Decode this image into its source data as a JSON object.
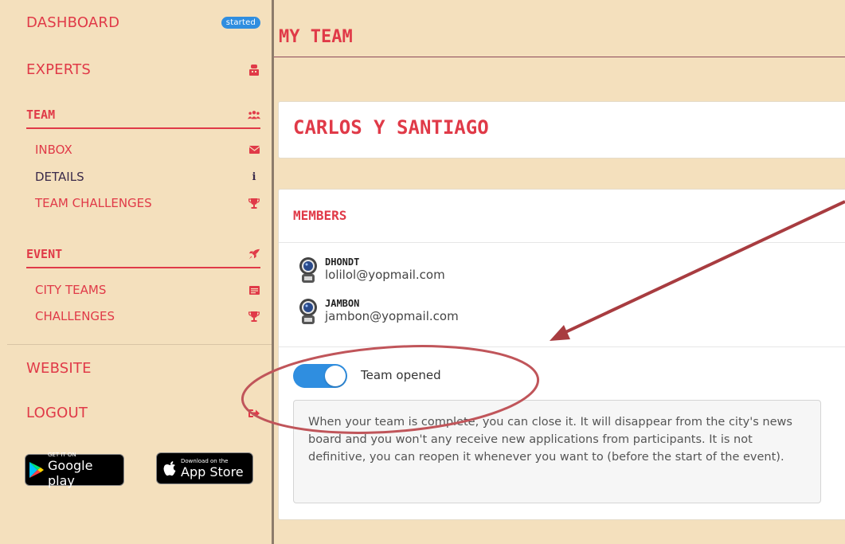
{
  "sidebar": {
    "dashboard": {
      "label": "DASHBOARD",
      "badge": "started"
    },
    "experts": {
      "label": "EXPERTS"
    },
    "team": {
      "heading": "TEAM",
      "items": [
        {
          "label": "INBOX",
          "icon": "envelope-icon"
        },
        {
          "label": "DETAILS",
          "icon": "info-icon"
        },
        {
          "label": "TEAM CHALLENGES",
          "icon": "trophy-icon"
        }
      ]
    },
    "event": {
      "heading": "EVENT",
      "items": [
        {
          "label": "CITY TEAMS",
          "icon": "card-icon"
        },
        {
          "label": "CHALLENGES",
          "icon": "trophy-icon"
        }
      ]
    },
    "website": {
      "label": "WEBSITE"
    },
    "logout": {
      "label": "LOGOUT"
    },
    "stores": {
      "google_small": "GET IT ON",
      "google_big": "Google play",
      "apple_small": "Download on the",
      "apple_big": "App Store"
    }
  },
  "main": {
    "page_title": "MY TEAM",
    "team_name": "CARLOS Y SANTIAGO",
    "members_heading": "MEMBERS",
    "members": [
      {
        "name": "DHONDT",
        "email": "lolilol@yopmail.com"
      },
      {
        "name": "JAMBON",
        "email": "jambon@yopmail.com"
      }
    ],
    "toggle": {
      "label": "Team opened",
      "state": "on"
    },
    "info_text": "When your team is complete, you can close it. It will disappear from the city's news board and you won't any receive new applications from participants. It is not definitive, you can reopen it whenever you want to (before the start of the event)."
  },
  "colors": {
    "accent": "#e03a48",
    "background": "#f4e0bd",
    "toggle": "#2f8ee0",
    "annotation": "#a83c40"
  }
}
